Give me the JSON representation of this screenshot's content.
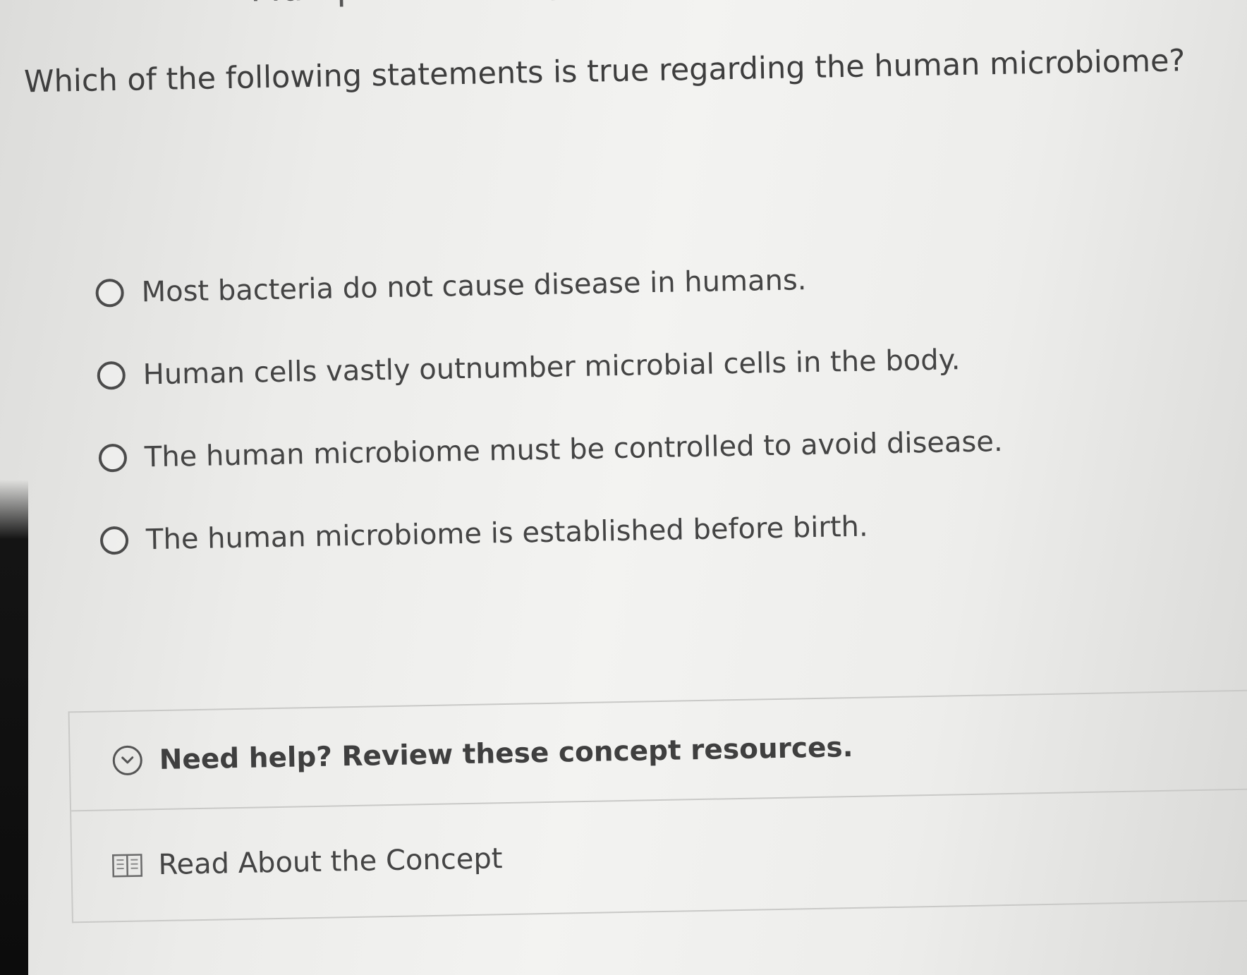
{
  "section_heading": "Multiple Choice Question",
  "question": "Which of the following statements is true regarding the human microbiome?",
  "options": [
    {
      "label": "Most bacteria do not cause disease in humans."
    },
    {
      "label": "Human cells vastly outnumber microbial cells in the body."
    },
    {
      "label": "The human microbiome must be controlled to avoid disease."
    },
    {
      "label": "The human microbiome is established before birth."
    }
  ],
  "help": {
    "title": "Need help? Review these concept resources.",
    "toggle_icon": "chevron-down-icon",
    "resources": [
      {
        "label": "Read About the Concept",
        "icon": "book-icon"
      }
    ]
  }
}
